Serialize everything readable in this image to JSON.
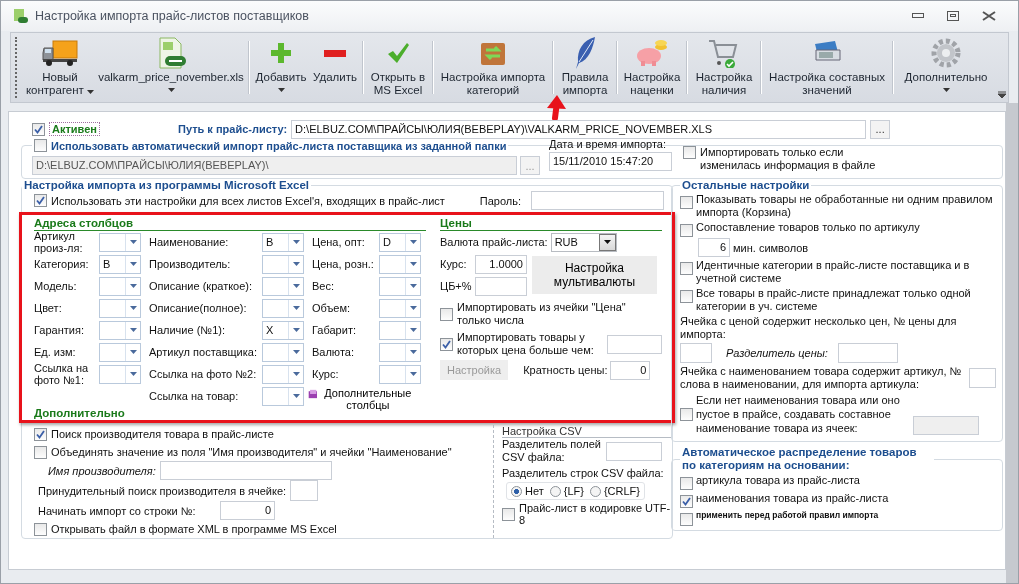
{
  "window": {
    "title": "Настройка импорта прайс-листов поставщиков"
  },
  "toolbar": [
    {
      "label": "Новый контрагент",
      "dropdown": true
    },
    {
      "label": "valkarm_price_november.xls",
      "dropdown": true
    },
    {
      "label": "Добавить",
      "dropdown": true
    },
    {
      "label": "Удалить",
      "dropdown": false
    },
    {
      "label": "Открыть в MS Excel",
      "dropdown": false
    },
    {
      "label": "Настройка импорта категорий",
      "dropdown": false
    },
    {
      "label": "Правила импорта",
      "dropdown": false
    },
    {
      "label": "Настройка наценки",
      "dropdown": false
    },
    {
      "label": "Настройка наличия",
      "dropdown": false
    },
    {
      "label": "Настройка составных значений",
      "dropdown": false
    },
    {
      "label": "Дополнительно",
      "dropdown": true
    }
  ],
  "active": {
    "label": "Активен",
    "checked": true
  },
  "price_list_path": {
    "label": "Путь к прайс-листу:",
    "value": "D:\\ELBUZ.COM\\ПРАЙСЫ\\ЮЛИЯ(BEBEPLAY)\\VALKARM_PRICE_NOVEMBER.XLS",
    "browse": "..."
  },
  "auto_import": {
    "label": "Использовать автоматический импорт прайс-листа поставщика из заданной папки",
    "checked": false,
    "folder": "D:\\ELBUZ.COM\\ПРАЙСЫ\\ЮЛИЯ(BEBEPLAY)\\",
    "browse": "..."
  },
  "import_date": {
    "label": "Дата и время импорта:",
    "value": "15/11/2010 15:47:20"
  },
  "only_if_changed": {
    "label": "Импортировать только если изменилась информация в файле",
    "checked": false
  },
  "excel": {
    "title": "Настройка импорта из программы Microsoft Excel",
    "use_for_all": {
      "label": "Использовать эти настройки для всех листов Excel'я, входящих в прайс-лист",
      "checked": true
    },
    "password_label": "Пароль:",
    "columns_title": "Адреса столбцов",
    "columns": [
      [
        {
          "label": "Артикул произ-ля:"
        },
        {
          "label": "Категория:",
          "value": "B"
        },
        {
          "label": "Модель:"
        },
        {
          "label": "Цвет:"
        },
        {
          "label": "Гарантия:"
        },
        {
          "label": "Ед. изм:"
        },
        {
          "label": "Ссылка на фото №1:"
        }
      ],
      [
        {
          "label": "Наименование:",
          "value": "B"
        },
        {
          "label": "Производитель:"
        },
        {
          "label": "Описание (краткое):"
        },
        {
          "label": "Описание(полное):"
        },
        {
          "label": "Наличие (№1):",
          "value": "X"
        },
        {
          "label": "Артикул поставщика:"
        },
        {
          "label": "Ссылка на фото №2:"
        },
        {
          "label": "Ссылка на товар:"
        }
      ],
      [
        {
          "label": "Цена, опт:",
          "value": "D"
        },
        {
          "label": "Цена, розн.:"
        },
        {
          "label": "Вес:"
        },
        {
          "label": "Объем:"
        },
        {
          "label": "Габарит:"
        },
        {
          "label": "Валюта:"
        },
        {
          "label": "Курс:"
        }
      ]
    ],
    "more_columns": "Дополнительные столбцы",
    "prices": {
      "title": "Цены",
      "currency_label": "Валюта прайс-листа:",
      "currency": "RUB",
      "rate_label": "Курс:",
      "rate": "1.0000",
      "cb_label": "ЦБ+%",
      "multicurrency": "Настройка мультивалюты",
      "numbers_only": {
        "label": "Импортировать из ячейки \"Цена\" только числа",
        "checked": false
      },
      "min_price": {
        "label": "Импортировать товары у которых цена больше чем:",
        "checked": true
      },
      "settings": {
        "label": "Настройка",
        "disabled": true
      },
      "multiplicity_label": "Кратность цены:",
      "multiplicity": "0"
    },
    "extra_title": "Дополнительно",
    "find_manufacturer": {
      "label": "Поиск производителя товара в прайс-листе",
      "checked": true
    },
    "merge_name": {
      "label": "Объединять значение из поля \"Имя производителя\" и ячейки \"Наименование\"",
      "checked": false
    },
    "manufacturer_name_label": "Имя производителя:",
    "forced_search_label": "Принудительный поиск производителя в ячейке:",
    "start_row": {
      "label": "Начинать импорт со строки №:",
      "value": "0"
    },
    "open_xml": {
      "label": "Открывать файл в формате XML в программе MS Excel",
      "checked": false
    },
    "csv": {
      "title": "Настройка CSV",
      "field_sep_label": "Разделитель полей CSV файла:",
      "row_sep_label": "Разделитель строк CSV файла:",
      "row_seps": [
        {
          "label": "Нет",
          "selected": true
        },
        {
          "label": "{LF}",
          "selected": false
        },
        {
          "label": "{CRLF}",
          "selected": false
        }
      ],
      "utf8": {
        "label": "Прайс-лист в кодировке UTF-8",
        "checked": false
      }
    }
  },
  "other": {
    "title": "Остальные настройки",
    "show_unprocessed": {
      "label": "Показывать товары не обработанные ни одним правилом импорта (Корзина)",
      "checked": false
    },
    "match_by_sku": {
      "label": "Сопоставление товаров только по артикулу",
      "checked": false
    },
    "min_chars": {
      "value": "6",
      "label": "мин. символов"
    },
    "identical_categories": {
      "label": "Идентичные категории в прайс-листе поставщика и в учетной системе",
      "checked": false
    },
    "single_category": {
      "label": "Все товары в прайс-листе принадлежат только одной категории в уч. системе",
      "checked": false
    },
    "multi_price": {
      "label": "Ячейка с ценой содержит несколько цен, № цены для импорта:",
      "separator_label": "Разделитель цены:"
    },
    "sku_in_name": {
      "label": "Ячейка с наименованием товара содержит артикул, № слова в наименовании, для импорта артикула:"
    },
    "composite_name": {
      "label": "Если нет наименования товара или оно пустое в прайсе, создавать составное наименование товара из ячеек:",
      "checked": false
    }
  },
  "auto_category": {
    "title": "Автоматическое распределение товаров по категориям на основании:",
    "options": [
      {
        "label": "артикула товара из прайс-листа",
        "checked": false,
        "kind": "option"
      },
      {
        "label": "наименования товара из прайс-листа",
        "checked": true,
        "kind": "option"
      },
      {
        "label": "применить перед работой правил импорта",
        "checked": false,
        "kind": "note"
      }
    ]
  }
}
